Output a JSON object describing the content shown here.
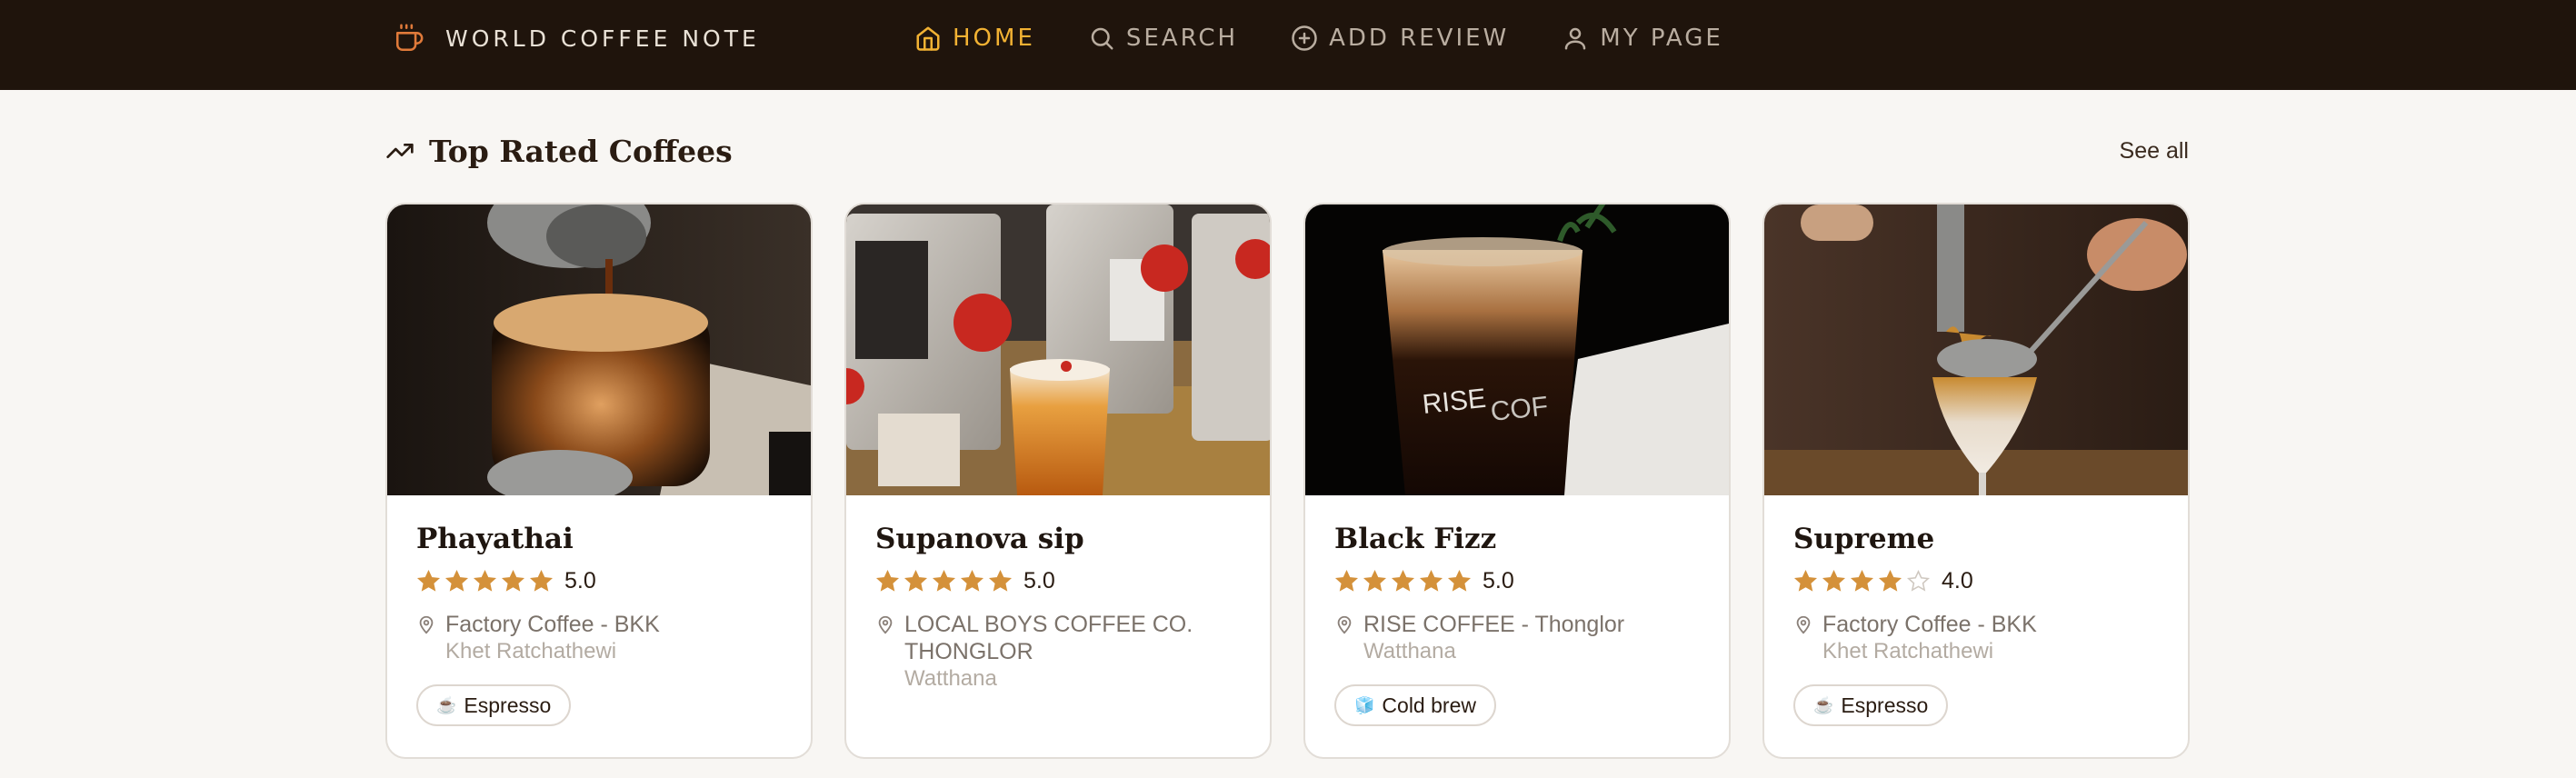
{
  "nav": {
    "brand": "WORLD COFFEE NOTE",
    "brand_icon": "coffee-cup-icon",
    "links": [
      {
        "label": "HOME",
        "icon": "home-icon",
        "active": true
      },
      {
        "label": "SEARCH",
        "icon": "search-icon",
        "active": false
      },
      {
        "label": "ADD REVIEW",
        "icon": "plus-circle-icon",
        "active": false
      },
      {
        "label": "MY PAGE",
        "icon": "user-icon",
        "active": false
      }
    ]
  },
  "section": {
    "title": "Top Rated Coffees",
    "icon": "trending-up-icon",
    "see_all": "See all"
  },
  "cards": [
    {
      "name": "Phayathai",
      "stars": 5,
      "rating": "5.0",
      "place": "Factory Coffee - BKK",
      "area": "Khet Ratchathewi",
      "tag_icon": "☕",
      "tag": "Espresso"
    },
    {
      "name": "Supanova sip",
      "stars": 5,
      "rating": "5.0",
      "place": "LOCAL BOYS COFFEE CO. THONGLOR",
      "area": "Watthana",
      "tag_icon": "",
      "tag": ""
    },
    {
      "name": "Black Fizz",
      "stars": 5,
      "rating": "5.0",
      "place": "RISE COFFEE - Thonglor",
      "area": "Watthana",
      "tag_icon": "🧊",
      "tag": "Cold brew"
    },
    {
      "name": "Supreme",
      "stars": 4,
      "rating": "4.0",
      "place": "Factory Coffee - BKK",
      "area": "Khet Ratchathewi",
      "tag_icon": "☕",
      "tag": "Espresso"
    }
  ],
  "colors": {
    "accent": "#f2b233",
    "star": "#d4913a",
    "nav_bg": "#1f140c"
  }
}
